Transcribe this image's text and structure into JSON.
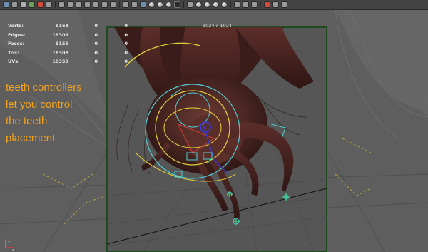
{
  "toolbar": {
    "icons": [
      "snap-icon",
      "select-icon",
      "move-icon",
      "render-icon",
      "ipr-icon",
      "camera-icon",
      "grid-icon",
      "film-icon",
      "isolate-icon",
      "wire-icon",
      "smooth-icon",
      "hardware-icon",
      "xray-icon",
      "texture-icon",
      "light-icon",
      "shadow-icon",
      "ao-icon",
      "aa-icon",
      "screen-icon",
      "sound-icon",
      "scissors-icon"
    ]
  },
  "hud": {
    "rows": [
      {
        "label": "Verts:",
        "v1": "9168",
        "v2": "0",
        "v3": "0"
      },
      {
        "label": "Edges:",
        "v1": "18309",
        "v2": "0",
        "v3": "0"
      },
      {
        "label": "Faces:",
        "v1": "9155",
        "v2": "0",
        "v3": "0"
      },
      {
        "label": "Tris:",
        "v1": "18308",
        "v2": "0",
        "v3": "0"
      },
      {
        "label": "UVs:",
        "v1": "10359",
        "v2": "0",
        "v3": "0"
      }
    ]
  },
  "resolution_gate_label": "1024 x 1024",
  "annotation": {
    "lines": [
      "teeth controllers",
      "let you control",
      "the teeth",
      "placement"
    ],
    "color": "#f2a21c"
  },
  "axis": {
    "y_label": "y",
    "x_label": "x"
  },
  "colors": {
    "viewport_bg": "#5e5e5e",
    "gate_border": "#1f4a1f",
    "controller_cyan": "#4fd0d8",
    "controller_yellow": "#e6d23a",
    "controller_red": "#d23c3c",
    "controller_blue": "#3a3ac8",
    "joint_green": "#38e87a"
  }
}
